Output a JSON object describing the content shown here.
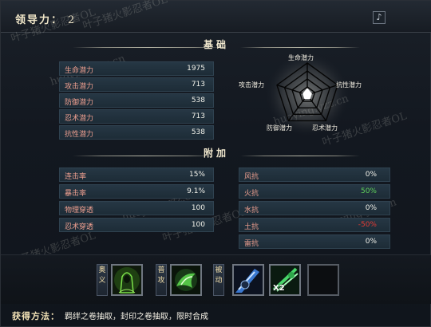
{
  "header": {
    "leadership_label": "领导力：",
    "leadership_value": "2",
    "music_icon": "music-note-icon"
  },
  "basic": {
    "title": "基础",
    "stats": [
      {
        "label": "生命潜力",
        "value": "1975"
      },
      {
        "label": "攻击潜力",
        "value": "713"
      },
      {
        "label": "防御潜力",
        "value": "538"
      },
      {
        "label": "忍术潜力",
        "value": "713"
      },
      {
        "label": "抗性潜力",
        "value": "538"
      }
    ],
    "radar_labels": [
      "生命潜力",
      "抗性潜力",
      "忍术潜力",
      "防御潜力",
      "攻击潜力"
    ]
  },
  "extra": {
    "title": "附加",
    "left_stats": [
      {
        "label": "连击率",
        "value": "15%"
      },
      {
        "label": "暴击率",
        "value": "9.1%"
      },
      {
        "label": "物理穿透",
        "value": "100"
      },
      {
        "label": "忍术穿透",
        "value": "100"
      }
    ],
    "right_stats": [
      {
        "label": "风抗",
        "value": "0%",
        "color": "#f2f2ea"
      },
      {
        "label": "火抗",
        "value": "50%",
        "color": "#5fd35a"
      },
      {
        "label": "水抗",
        "value": "0%",
        "color": "#f2f2ea"
      },
      {
        "label": "土抗",
        "value": "-50%",
        "color": "#e43b34"
      },
      {
        "label": "雷抗",
        "value": "0%",
        "color": "#f2f2ea"
      }
    ]
  },
  "skills": {
    "categories": [
      "奥义",
      "普攻",
      "被动"
    ],
    "icons": [
      "hooded-ninja-skill-icon",
      "green-palm-skill-icon",
      "blue-blade-skill-icon",
      "green-dash-skill-icon",
      "empty-skill-slot"
    ],
    "x2_badge": "X2"
  },
  "obtain": {
    "label": "获得方法：",
    "text": "羁绊之卷抽取，封印之卷抽取，限时合成"
  },
  "watermark": {
    "text1": "叶子猪火影忍者OL",
    "text2": "huoying.yzz.cn"
  },
  "colors": {
    "stat_label": "#f0a090",
    "positive": "#5fd35a",
    "negative": "#e43b34"
  }
}
